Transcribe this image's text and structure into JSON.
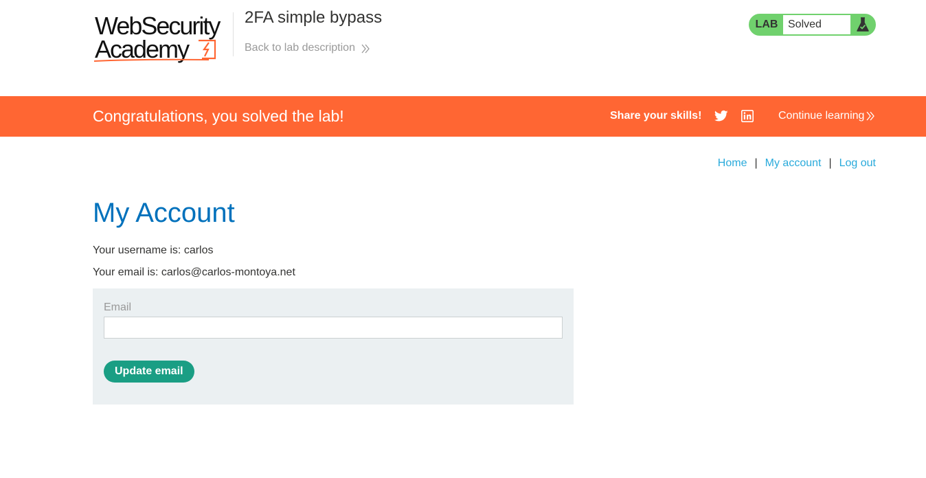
{
  "header": {
    "logo_line1": "WebSecurity",
    "logo_line2": "Academy",
    "lab_title": "2FA simple bypass",
    "back_link": "Back to lab description",
    "status": {
      "tag": "LAB",
      "text": "Solved"
    }
  },
  "banner": {
    "message": "Congratulations, you solved the lab!",
    "share_label": "Share your skills!",
    "continue_label": "Continue learning"
  },
  "nav": {
    "home": "Home",
    "my_account": "My account",
    "log_out": "Log out",
    "separator": "|"
  },
  "main": {
    "title": "My Account",
    "username_line": "Your username is: carlos",
    "email_line": "Your email is: carlos@carlos-montoya.net",
    "form": {
      "email_label": "Email",
      "email_value": "",
      "button_label": "Update email"
    }
  },
  "colors": {
    "banner": "#ff6633",
    "title_blue": "#0071bc",
    "link_blue": "#29aadb",
    "button_green": "#1a9e84",
    "status_green": "#70d16d",
    "panel_bg": "#ebf0f2"
  },
  "icons": [
    "double-chevron-right-icon",
    "flask-icon",
    "twitter-icon",
    "linkedin-icon",
    "bolt-icon"
  ]
}
